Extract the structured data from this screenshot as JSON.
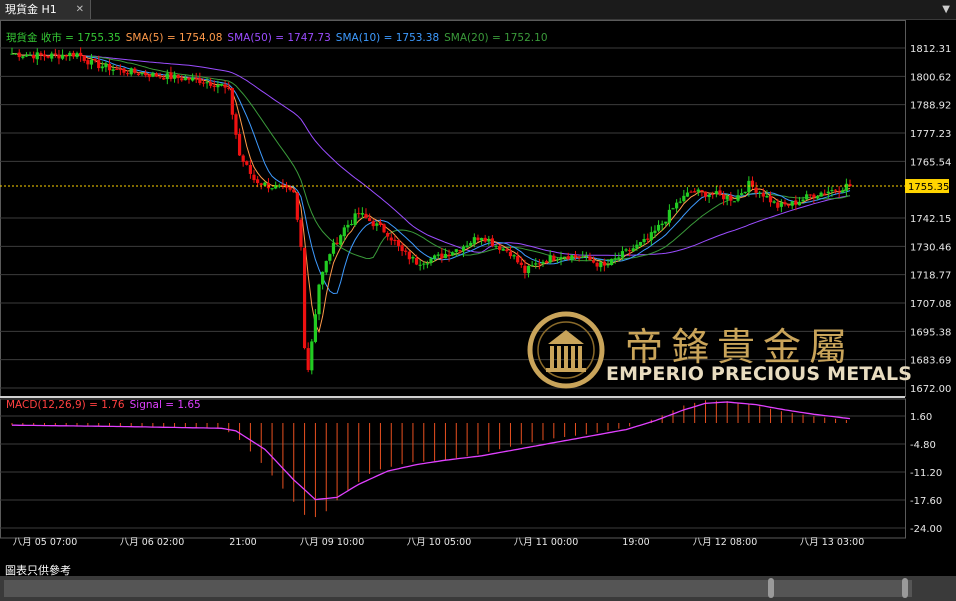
{
  "tab": {
    "title": "現貨金 H1",
    "close": "✕"
  },
  "legend_main": [
    {
      "label": "現貨金 收市 = 1755.35",
      "color": "#35c935"
    },
    {
      "label": "SMA(5) = 1754.08",
      "color": "#ff9a4a"
    },
    {
      "label": "SMA(50) = 1747.73",
      "color": "#9b4dff"
    },
    {
      "label": "SMA(10) = 1753.38",
      "color": "#3e9bff"
    },
    {
      "label": "SMA(20) = 1752.10",
      "color": "#3a9a3a"
    }
  ],
  "legend_macd": [
    {
      "label": "MACD(12,26,9) = 1.76",
      "color": "#ff4040"
    },
    {
      "label": "Signal = 1.65",
      "color": "#e040ff"
    }
  ],
  "disclaimer": "圖表只供參考",
  "logo": {
    "cn": "帝鋒貴金屬",
    "en": "EMPERIO PRECIOUS METALS"
  },
  "colors": {
    "up": "#22cc22",
    "down": "#ee1111",
    "macd_hist": "#e85020",
    "signal": "#e040ff",
    "last_price": "#ffd400"
  },
  "chart_data": {
    "type": "candlestick",
    "last_price": 1755.35,
    "y_ticks": [
      1812.31,
      1800.62,
      1788.92,
      1777.23,
      1765.54,
      1742.15,
      1730.46,
      1718.77,
      1707.08,
      1695.38,
      1683.69,
      1672.0
    ],
    "ylim": [
      1672.0,
      1818.0
    ],
    "x_labels": [
      "八月 05 07:00",
      "八月 06 02:00",
      "21:00",
      "八月 09 10:00",
      "八月 10 05:00",
      "八月 11 00:00",
      "19:00",
      "八月 12 08:00",
      "八月 13 03:00"
    ],
    "close_keypoints": [
      [
        0,
        1810
      ],
      [
        10,
        1809
      ],
      [
        18,
        1810
      ],
      [
        22,
        1806
      ],
      [
        30,
        1803
      ],
      [
        40,
        1801
      ],
      [
        52,
        1799
      ],
      [
        58,
        1797
      ],
      [
        60,
        1794
      ],
      [
        63,
        1768
      ],
      [
        67,
        1758
      ],
      [
        70,
        1756
      ],
      [
        75,
        1754
      ],
      [
        78,
        1752
      ],
      [
        80,
        1730
      ],
      [
        81,
        1690
      ],
      [
        82,
        1680
      ],
      [
        85,
        1715
      ],
      [
        88,
        1728
      ],
      [
        92,
        1738
      ],
      [
        96,
        1744
      ],
      [
        100,
        1740
      ],
      [
        104,
        1736
      ],
      [
        108,
        1728
      ],
      [
        112,
        1724
      ],
      [
        118,
        1726
      ],
      [
        124,
        1730
      ],
      [
        130,
        1735
      ],
      [
        134,
        1731
      ],
      [
        138,
        1728
      ],
      [
        142,
        1720
      ],
      [
        146,
        1724
      ],
      [
        152,
        1727
      ],
      [
        158,
        1726
      ],
      [
        164,
        1722
      ],
      [
        170,
        1728
      ],
      [
        176,
        1733
      ],
      [
        180,
        1740
      ],
      [
        184,
        1748
      ],
      [
        188,
        1753
      ],
      [
        194,
        1752
      ],
      [
        200,
        1750
      ],
      [
        204,
        1756
      ],
      [
        208,
        1752
      ],
      [
        212,
        1747
      ],
      [
        216,
        1748
      ],
      [
        222,
        1752
      ],
      [
        228,
        1754
      ],
      [
        232,
        1756
      ]
    ],
    "macd_yticks": [
      1.6,
      -4.8,
      -11.2,
      -17.6,
      -24.0
    ],
    "macd_ylim": [
      -26.0,
      6.0
    ],
    "macd_keypoints": [
      [
        0,
        -0.5
      ],
      [
        30,
        -0.8
      ],
      [
        58,
        -1.2
      ],
      [
        62,
        -3
      ],
      [
        70,
        -10
      ],
      [
        78,
        -18
      ],
      [
        82,
        -22
      ],
      [
        86,
        -21
      ],
      [
        92,
        -16
      ],
      [
        100,
        -11
      ],
      [
        110,
        -9
      ],
      [
        120,
        -8.5
      ],
      [
        130,
        -7
      ],
      [
        140,
        -5
      ],
      [
        150,
        -3.5
      ],
      [
        160,
        -2.5
      ],
      [
        170,
        -1
      ],
      [
        178,
        1
      ],
      [
        186,
        4
      ],
      [
        192,
        5.2
      ],
      [
        198,
        5
      ],
      [
        206,
        4
      ],
      [
        214,
        2.5
      ],
      [
        222,
        1.5
      ],
      [
        232,
        0.6
      ]
    ],
    "signal_keypoints": [
      [
        0,
        -0.5
      ],
      [
        30,
        -0.8
      ],
      [
        58,
        -1.2
      ],
      [
        62,
        -1.8
      ],
      [
        70,
        -6
      ],
      [
        78,
        -13
      ],
      [
        84,
        -17.5
      ],
      [
        90,
        -17
      ],
      [
        96,
        -14
      ],
      [
        104,
        -11
      ],
      [
        112,
        -9.5
      ],
      [
        120,
        -8.5
      ],
      [
        130,
        -7.5
      ],
      [
        140,
        -6
      ],
      [
        150,
        -4.5
      ],
      [
        160,
        -3
      ],
      [
        170,
        -1.5
      ],
      [
        178,
        0.5
      ],
      [
        186,
        3
      ],
      [
        192,
        4.5
      ],
      [
        198,
        4.8
      ],
      [
        206,
        4.2
      ],
      [
        214,
        3
      ],
      [
        222,
        2
      ],
      [
        232,
        1.0
      ]
    ]
  }
}
